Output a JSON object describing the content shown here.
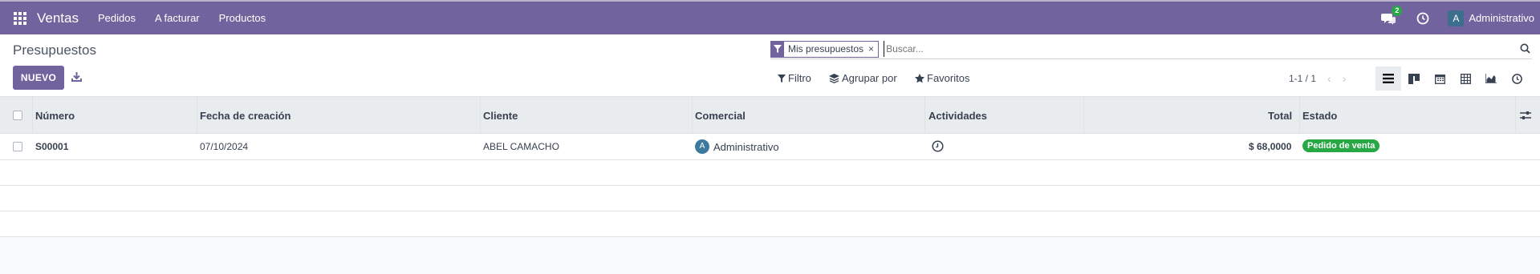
{
  "navbar": {
    "app_name": "Ventas",
    "menu": [
      "Pedidos",
      "A facturar",
      "Productos"
    ],
    "chat_badge": "2",
    "user_initial": "A",
    "user_name": "Administrativo",
    "bg_color": "#71639e"
  },
  "control_panel": {
    "breadcrumb": "Presupuestos",
    "new_button": "NUEVO",
    "search": {
      "facet": "Mis presupuestos",
      "facet_close": "×",
      "placeholder": "Buscar..."
    },
    "filters": {
      "filter": "Filtro",
      "group_by": "Agrupar por",
      "favorites": "Favoritos"
    },
    "pager": "1-1 / 1",
    "views": [
      "list-view-icon",
      "kanban-view-icon",
      "calendar-view-icon",
      "pivot-view-icon",
      "graph-view-icon",
      "activity-view-icon"
    ]
  },
  "table": {
    "columns": [
      "Número",
      "Fecha de creación",
      "Cliente",
      "Comercial",
      "Actividades",
      "Total",
      "Estado"
    ],
    "rows": [
      {
        "number": "S00001",
        "date": "07/10/2024",
        "customer": "ABEL CAMACHO",
        "salesperson_initial": "A",
        "salesperson": "Administrativo",
        "total": "$ 68,0000",
        "status": "Pedido de venta"
      }
    ]
  },
  "colors": {
    "accent": "#71639e",
    "status_green": "#28a745"
  }
}
